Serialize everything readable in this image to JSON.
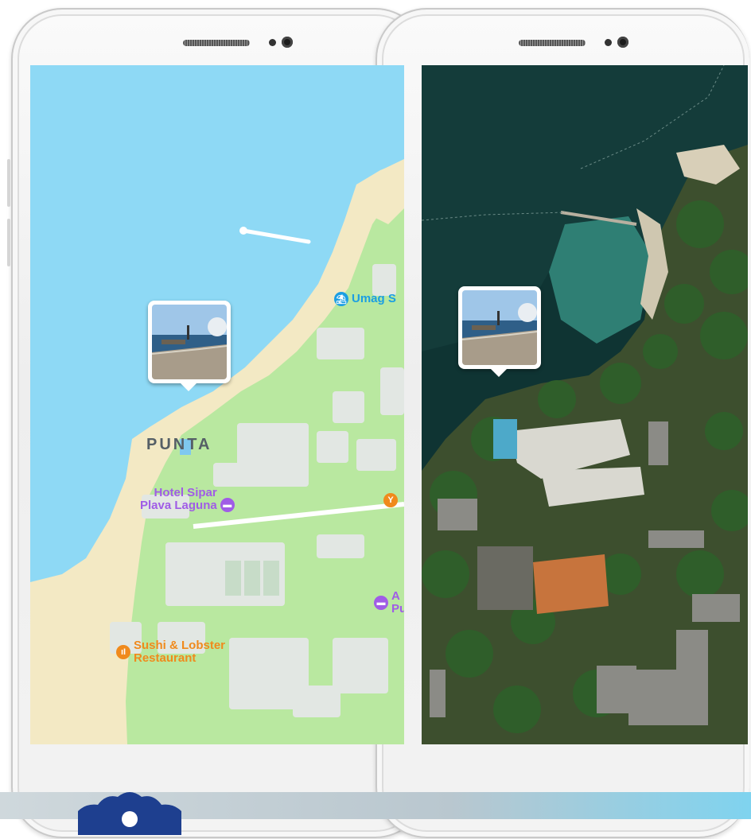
{
  "map_left": {
    "district": "PUNTA",
    "pois": [
      {
        "name": "Umag S",
        "type": "beach",
        "color": "#1a9ee3"
      },
      {
        "name": "Hotel Sipar\nPlava Laguna",
        "type": "hotel",
        "color": "#a05ce6"
      },
      {
        "name": "A\nPu",
        "type": "hotel",
        "color": "#a05ce6"
      },
      {
        "name": "Sushi & Lobster\nRestaurant",
        "type": "restaurant",
        "color": "#f08a1c"
      },
      {
        "name": "",
        "type": "bar",
        "color": "#f08a1c"
      }
    ],
    "photo_pin": {
      "icon": "photo-thumbnail"
    }
  },
  "map_right": {
    "view": "satellite",
    "photo_pin": {
      "icon": "photo-thumbnail"
    }
  },
  "colors": {
    "water": "#8ed9f5",
    "land": "#b9e8a0",
    "sand": "#f3e9c4",
    "building": "#e2e7e3",
    "hotel": "#a05ce6",
    "restaurant": "#f08a1c",
    "beach_icon": "#1a9ee3",
    "badge": "#1e3f8f"
  }
}
